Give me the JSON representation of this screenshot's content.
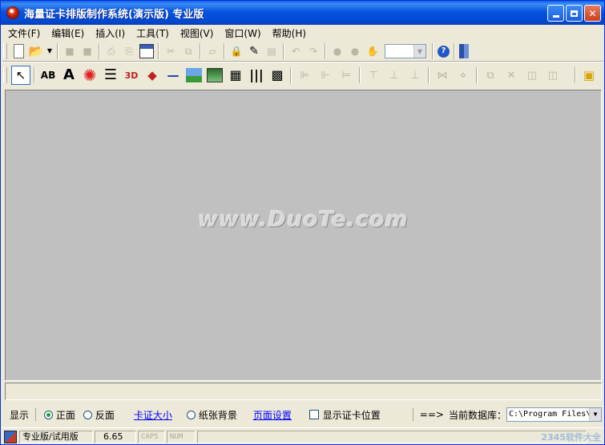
{
  "title": "海量证卡排版制作系统(演示版) 专业版",
  "menu": [
    "文件(F)",
    "编辑(E)",
    "插入(I)",
    "工具(T)",
    "视图(V)",
    "窗口(W)",
    "帮助(H)"
  ],
  "watermark": "www.DuoTe.com",
  "options": {
    "display_label": "显示",
    "front_label": "正面",
    "back_label": "反面",
    "card_size_link": "卡证大小",
    "paper_bg_label": "纸张背景",
    "page_setup_link": "页面设置",
    "show_pos_label": "显示证卡位置",
    "arrow": "==>",
    "db_label": "当前数据库：",
    "db_value": "C:\\Program Files\\"
  },
  "status": {
    "edition": "专业版/试用版",
    "version": "6.65",
    "caps": "CAPS",
    "num": "NUM"
  },
  "corner_logo": "2345软件大全"
}
